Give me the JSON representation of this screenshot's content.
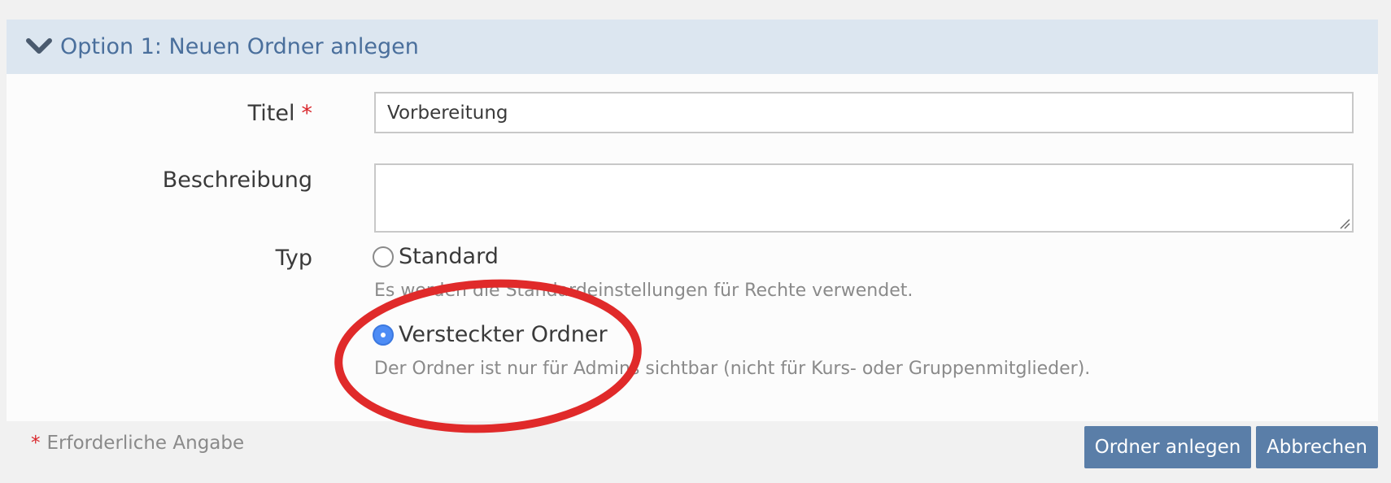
{
  "panel": {
    "title": "Option 1: Neuen Ordner anlegen",
    "expanded": true
  },
  "form": {
    "title_label": "Titel",
    "title_required_mark": "*",
    "title_value": "Vorbereitung",
    "description_label": "Beschreibung",
    "description_value": "",
    "type_label": "Typ",
    "type_options": [
      {
        "label": "Standard",
        "help": "Es werden die Standardeinstellungen für Rechte verwendet.",
        "selected": false
      },
      {
        "label": "Versteckter Ordner",
        "help": "Der Ordner ist nur für Admins sichtbar (nicht für Kurs- oder Gruppenmitglieder).",
        "selected": true
      }
    ]
  },
  "footer": {
    "required_mark": "*",
    "required_note": "Erforderliche Angabe",
    "create_label": "Ordner anlegen",
    "cancel_label": "Abbrechen"
  },
  "colors": {
    "header_bg": "#dce6f0",
    "header_text": "#4a6f9c",
    "button_bg": "#5a7ea8",
    "required": "#d9262b",
    "radio_selected": "#4d8cf5",
    "highlight": "#e02a2a"
  },
  "icons": {
    "panel_toggle": "chevron-down-icon",
    "highlight": "red-ellipse-annotation"
  }
}
